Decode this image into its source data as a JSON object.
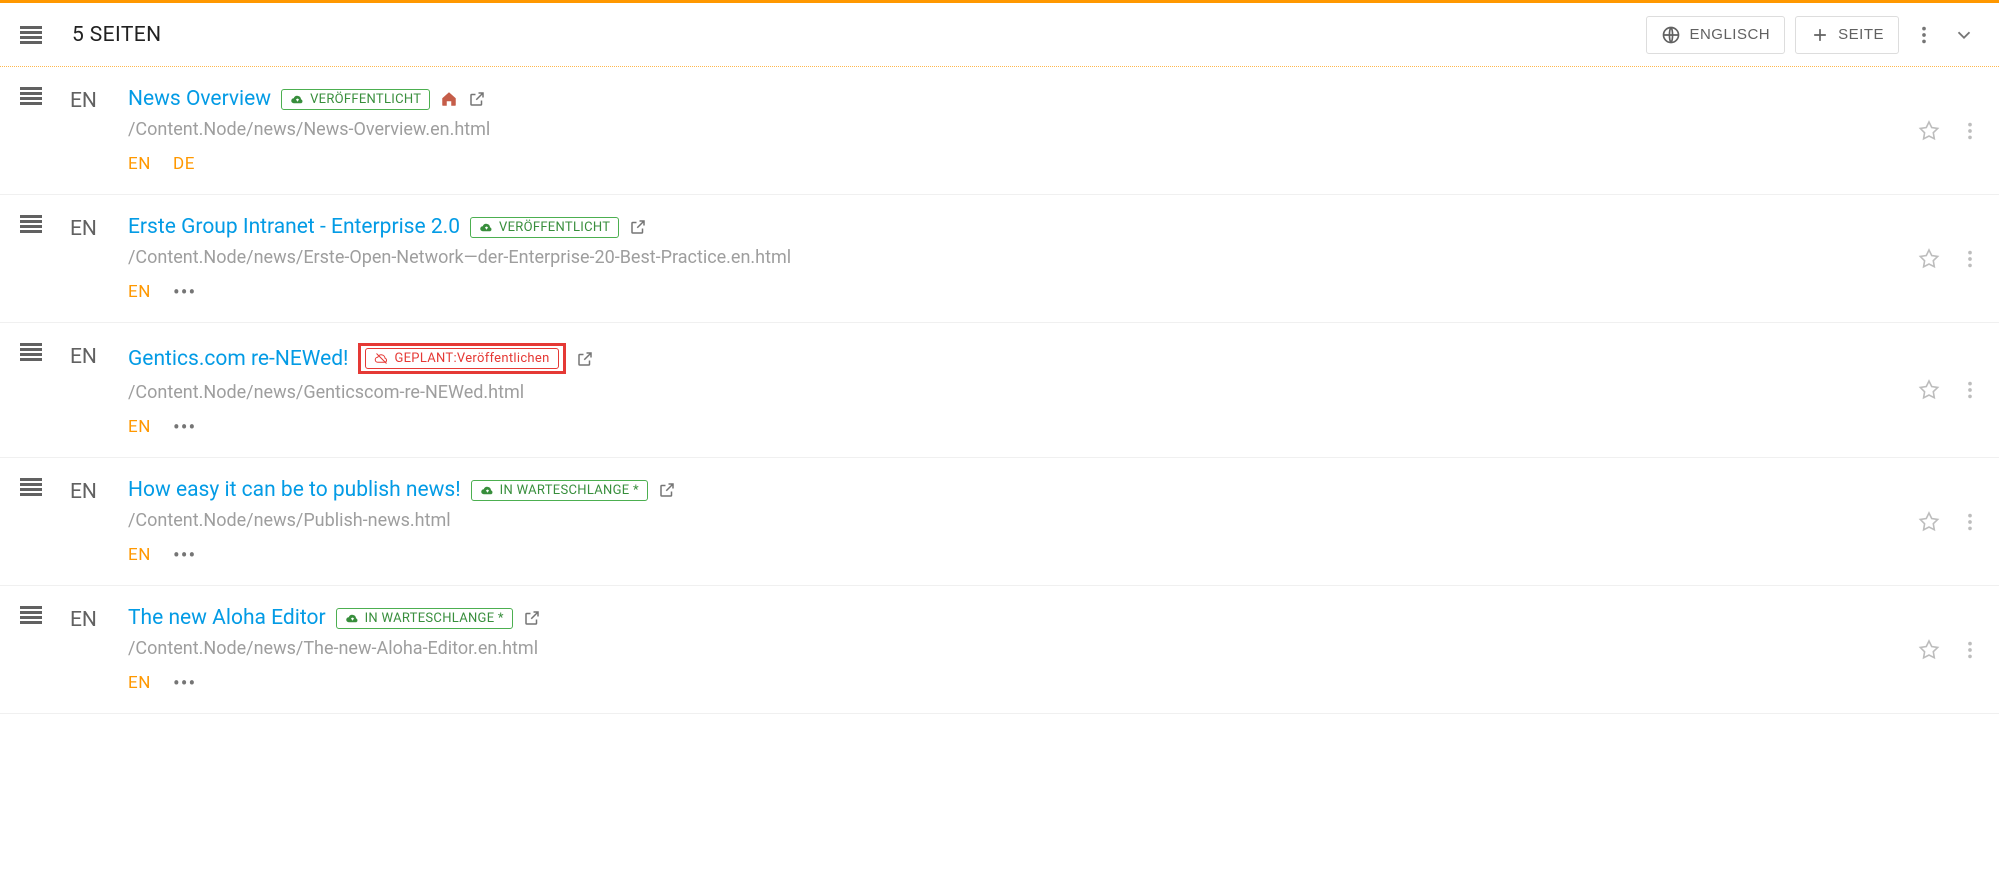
{
  "header": {
    "title": "5 SEITEN",
    "lang_button": "ENGLISCH",
    "add_button": "SEITE"
  },
  "statuses": {
    "published": "VERÖFFENTLICHT",
    "queue": "IN WARTESCHLANGE *",
    "planned": "GEPLANT:Veröffentlichen"
  },
  "pages": [
    {
      "lang": "EN",
      "title": "News Overview",
      "status": "published",
      "is_home": true,
      "highlighted": false,
      "path": "/Content.Node/news/News-Overview.en.html",
      "languages": [
        "EN",
        "DE"
      ],
      "show_more": false
    },
    {
      "lang": "EN",
      "title": "Erste Group Intranet - Enterprise 2.0",
      "status": "published",
      "is_home": false,
      "highlighted": false,
      "path": "/Content.Node/news/Erste-Open-Network—der-Enterprise-20-Best-Practice.en.html",
      "languages": [
        "EN"
      ],
      "show_more": true
    },
    {
      "lang": "EN",
      "title": "Gentics.com re-NEWed!",
      "status": "planned",
      "is_home": false,
      "highlighted": true,
      "path": "/Content.Node/news/Genticscom-re-NEWed.html",
      "languages": [
        "EN"
      ],
      "show_more": true
    },
    {
      "lang": "EN",
      "title": "How easy it can be to publish news!",
      "status": "queue",
      "is_home": false,
      "highlighted": false,
      "path": "/Content.Node/news/Publish-news.html",
      "languages": [
        "EN"
      ],
      "show_more": true
    },
    {
      "lang": "EN",
      "title": "The new Aloha Editor",
      "status": "queue",
      "is_home": false,
      "highlighted": false,
      "path": "/Content.Node/news/The-new-Aloha-Editor.en.html",
      "languages": [
        "EN"
      ],
      "show_more": true
    }
  ]
}
